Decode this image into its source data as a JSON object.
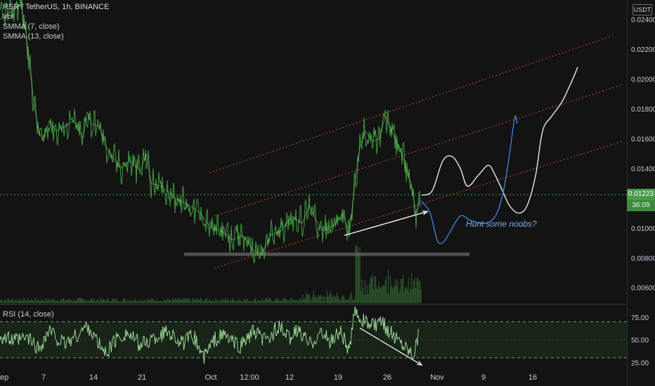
{
  "legend": {
    "title": "RSR / TetherUS, 1h, BINANCE",
    "lines": [
      "Vol",
      "SMMA (7, close)",
      "SMMA (13, close)"
    ],
    "rsi": "RSI (14, close)"
  },
  "currency_button": "USDT",
  "last_price": "0.01223",
  "countdown": "36:09",
  "annotation": "Hunt some noobs?",
  "colors": {
    "background": "#131313",
    "price": "#3f9b3f",
    "price_light": "#9fe39a",
    "channel": "#d94a4a",
    "forecast_white": "#e8e8e8",
    "forecast_blue": "#3a7fd4",
    "support_zone": "#6a6a6a",
    "rsi_line": "#a8e6a0",
    "rsi_band": "#1a2a1a"
  },
  "chart_data": [
    {
      "type": "line",
      "title": "RSR / TetherUS, 1h, BINANCE",
      "x_ticks": [
        "ep",
        "7",
        "14",
        "21",
        "Oct",
        "12:00",
        "12",
        "19",
        "26",
        "Nov",
        "9",
        "16"
      ],
      "y_ticks": [
        0.024,
        0.022,
        0.02,
        0.018,
        0.016,
        0.014,
        0.012,
        0.01,
        0.008,
        0.006
      ],
      "y_tick_labels": [
        "0.02400",
        "0.02200",
        "0.02000",
        "0.01800",
        "0.01600",
        "0.01400",
        "0.01200",
        "0.01000",
        "0.00800",
        "0.00600"
      ],
      "ylim": [
        0.00495,
        0.0253
      ],
      "x_domain": [
        0,
        930
      ],
      "series": [
        {
          "role": "price",
          "x": [
            0,
            30,
            36,
            42,
            48,
            55,
            62,
            70,
            80,
            92,
            105,
            118,
            124,
            130,
            142,
            150,
            160,
            172,
            185,
            200,
            208,
            215,
            230,
            250,
            270,
            285,
            300,
            315,
            330,
            345,
            360,
            372,
            385,
            400,
            415,
            430,
            440,
            450,
            460,
            475,
            488,
            497,
            505,
            512,
            520,
            530,
            540,
            548,
            555,
            562,
            570,
            578,
            585,
            592,
            598
          ],
          "y": [
            0.024,
            0.025,
            0.0235,
            0.021,
            0.0185,
            0.0165,
            0.0158,
            0.0172,
            0.0165,
            0.0168,
            0.0172,
            0.016,
            0.0178,
            0.017,
            0.0168,
            0.0155,
            0.0148,
            0.014,
            0.0145,
            0.0138,
            0.015,
            0.013,
            0.0128,
            0.012,
            0.0115,
            0.011,
            0.01,
            0.0098,
            0.0092,
            0.0095,
            0.0085,
            0.0082,
            0.0095,
            0.0098,
            0.0108,
            0.0103,
            0.0115,
            0.0105,
            0.0098,
            0.0102,
            0.011,
            0.0095,
            0.013,
            0.0155,
            0.0165,
            0.0158,
            0.016,
            0.0175,
            0.0168,
            0.016,
            0.0152,
            0.014,
            0.013,
            0.011,
            0.012
          ]
        },
        {
          "role": "forecast_white",
          "x": [
            600,
            615,
            630,
            643,
            655,
            665,
            680,
            695,
            705,
            715,
            725,
            738,
            750,
            762,
            772,
            785,
            800,
            815,
            822
          ],
          "y": [
            0.0122,
            0.0125,
            0.0145,
            0.0148,
            0.014,
            0.0128,
            0.0135,
            0.0142,
            0.0135,
            0.0125,
            0.0115,
            0.011,
            0.0115,
            0.0135,
            0.0165,
            0.0175,
            0.0185,
            0.02,
            0.0208
          ]
        },
        {
          "role": "forecast_blue",
          "x": [
            600,
            612,
            622,
            630,
            640,
            655,
            670,
            690,
            705,
            715,
            722,
            728,
            733,
            736
          ],
          "y": [
            0.0118,
            0.011,
            0.0092,
            0.009,
            0.0097,
            0.0108,
            0.0105,
            0.0103,
            0.0108,
            0.0122,
            0.014,
            0.016,
            0.0175,
            0.017
          ]
        },
        {
          "role": "channel",
          "x": [
            298,
            872
          ],
          "y": [
            0.0137,
            0.0229
          ]
        },
        {
          "role": "channel",
          "x": [
            305,
            885
          ],
          "y": [
            0.0108,
            0.0196
          ]
        },
        {
          "role": "channel",
          "x": [
            305,
            885
          ],
          "y": [
            0.0073,
            0.0158
          ]
        },
        {
          "role": "trend_arrow",
          "x": [
            490,
            608
          ],
          "y": [
            0.0095,
            0.0111
          ]
        }
      ],
      "support_zone": {
        "x": [
          262,
          668
        ],
        "y": [
          0.00835,
          0.00812
        ]
      },
      "last_price_line": 0.01223
    },
    {
      "type": "bar",
      "title": "Vol",
      "x": [
        0,
        600
      ],
      "note": "volume histogram along the bottom of the price pane; spike near Oct 21"
    },
    {
      "type": "line",
      "title": "RSI (14, close)",
      "y_ticks": [
        75,
        50,
        25
      ],
      "y_tick_labels": [
        "75.00",
        "50.00",
        "25.00"
      ],
      "ylim": [
        19,
        89
      ],
      "band": [
        30,
        70
      ],
      "series": [
        {
          "role": "rsi",
          "x": [
            0,
            20,
            40,
            55,
            70,
            90,
            110,
            125,
            140,
            150,
            165,
            180,
            200,
            220,
            240,
            260,
            275,
            290,
            305,
            320,
            340,
            360,
            380,
            395,
            410,
            425,
            440,
            455,
            470,
            485,
            497,
            505,
            512,
            520,
            530,
            545,
            560,
            575,
            588,
            596
          ],
          "y": [
            55,
            48,
            52,
            40,
            60,
            45,
            55,
            66,
            45,
            35,
            50,
            58,
            44,
            52,
            60,
            45,
            55,
            30,
            50,
            55,
            42,
            58,
            48,
            65,
            52,
            60,
            45,
            58,
            48,
            60,
            35,
            85,
            75,
            70,
            65,
            68,
            55,
            45,
            35,
            58
          ]
        },
        {
          "role": "divergence_arrow",
          "x": [
            512,
            600
          ],
          "y": [
            63,
            22
          ]
        }
      ]
    }
  ]
}
